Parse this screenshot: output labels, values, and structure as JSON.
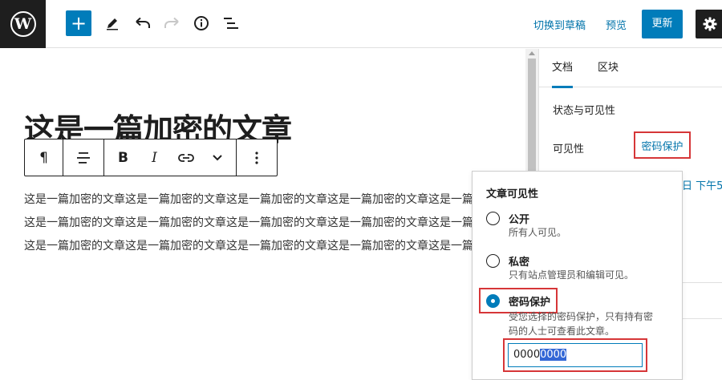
{
  "toolbar": {
    "logo_letter": "W",
    "add_label": "+",
    "switch_draft": "切换到草稿",
    "preview": "预览",
    "update": "更新"
  },
  "editor": {
    "title": "这是一篇加密的文章",
    "paragraph_lines": [
      "这是一篇加密的文章这是一篇加密的文章这是一篇加密的文章这是一篇加密的文章这是一篇加密的文",
      "这是一篇加密的文章这是一篇加密的文章这是一篇加密的文章这是一篇加密的文章这是一篇加密的文",
      "这是一篇加密的文章这是一篇加密的文章这是一篇加密的文章这是一篇加密的文章这是一篇加密的文"
    ],
    "block_toolbar": {
      "paragraph_symbol": "¶",
      "bold": "B",
      "italic": "I"
    }
  },
  "sidebar": {
    "tabs": [
      "文档",
      "区块"
    ],
    "panel_title": "状态与可见性",
    "visibility_label": "可见性",
    "visibility_value": "密码保护",
    "publish_peek": "日 下午5"
  },
  "popover": {
    "title": "文章可见性",
    "options": [
      {
        "label": "公开",
        "desc": "所有人可见。",
        "checked": false
      },
      {
        "label": "私密",
        "desc": "只有站点管理员和编辑可见。",
        "checked": false
      },
      {
        "label": "密码保护",
        "desc_line1": "受您选择的密码保护，只有持有密",
        "desc_line2": "码的人士可查看此文章。",
        "checked": true
      }
    ],
    "password_prefix": "0000",
    "password_selected": "0000"
  },
  "colors": {
    "accent": "#007cba",
    "highlight": "#d63638",
    "dark": "#1e1e1e"
  }
}
